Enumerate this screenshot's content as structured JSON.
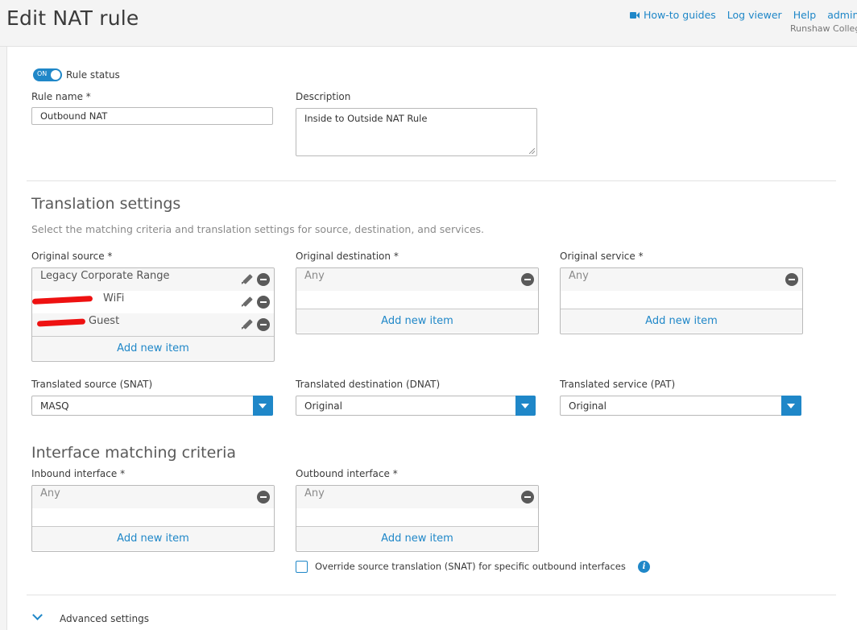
{
  "header": {
    "title": "Edit NAT rule",
    "links": [
      "How-to guides",
      "Log viewer",
      "Help",
      "admin"
    ],
    "org_name": "Runshaw College"
  },
  "rule": {
    "status_toggle": "ON",
    "status_label": "Rule status",
    "name_label": "Rule name *",
    "name_value": "Outbound NAT",
    "description_label": "Description",
    "description_value": "Inside to Outside NAT Rule"
  },
  "translation": {
    "title": "Translation settings",
    "description": "Select the matching criteria and translation settings for source, destination, and services.",
    "original_source": {
      "label": "Original source *",
      "items": [
        "Legacy Corporate Range",
        "WiFi",
        "Guest"
      ],
      "add_label": "Add new item"
    },
    "original_destination": {
      "label": "Original destination *",
      "items": [
        "Any"
      ],
      "add_label": "Add new item"
    },
    "original_service": {
      "label": "Original service *",
      "items": [
        "Any"
      ],
      "add_label": "Add new item"
    },
    "translated_source": {
      "label": "Translated source (SNAT)",
      "value": "MASQ"
    },
    "translated_destination": {
      "label": "Translated destination (DNAT)",
      "value": "Original"
    },
    "translated_service": {
      "label": "Translated service (PAT)",
      "value": "Original"
    }
  },
  "interface": {
    "title": "Interface matching criteria",
    "inbound": {
      "label": "Inbound interface *",
      "items": [
        "Any"
      ],
      "add_label": "Add new item"
    },
    "outbound": {
      "label": "Outbound interface *",
      "items": [
        "Any"
      ],
      "add_label": "Add new item"
    },
    "override_label": "Override source translation (SNAT) for specific outbound interfaces",
    "override_checked": false
  },
  "advanced": {
    "label": "Advanced settings"
  },
  "colors": {
    "accent": "#1f87c8",
    "redaction": "#ee1111"
  }
}
